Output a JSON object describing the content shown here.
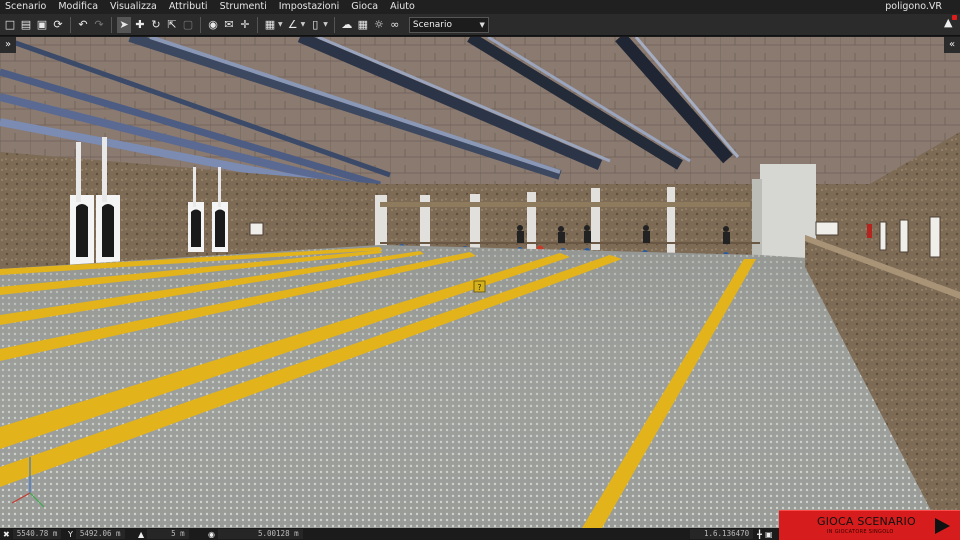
{
  "menubar": {
    "items": [
      "Scenario",
      "Modifica",
      "Visualizza",
      "Attributi",
      "Strumenti",
      "Impostazioni",
      "Gioca",
      "Aiuto"
    ],
    "app_title": "poligono.VR"
  },
  "toolbar": {
    "file_icons": [
      "new-file-icon",
      "open-folder-icon",
      "save-icon",
      "refresh-icon"
    ],
    "history_icons": [
      "undo-icon",
      "redo-icon"
    ],
    "transform_icons": [
      "select-arrow-icon",
      "move-icon",
      "rotate-icon",
      "scale-icon",
      "bounds-icon"
    ],
    "view_icons": [
      "globe-icon",
      "mail-icon",
      "crosshair-icon"
    ],
    "grid_icons": [
      "grid-icon",
      "angle-icon",
      "ruler-icon"
    ],
    "environment_icons": [
      "weather-icon",
      "city-icon",
      "sun-icon",
      "goggles-icon"
    ],
    "scenario_select": "Scenario"
  },
  "panels": {
    "left_toggle": "»",
    "right_toggle": "«"
  },
  "statusbar": {
    "x_value": "5540.78 m",
    "y_value": "5492.06 m",
    "z_value": "5 m",
    "view_value": "5.00128 m",
    "time_value": "1.6.136470"
  },
  "play": {
    "label": "GIOCA SCENARIO",
    "sublabel": "IN GIOCATORE SINGOLO"
  }
}
